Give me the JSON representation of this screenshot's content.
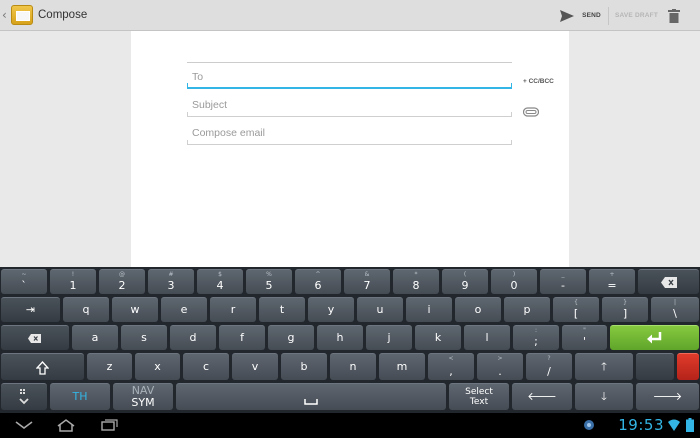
{
  "actionbar": {
    "title": "Compose",
    "send_label": "SEND",
    "save_draft_label": "SAVE DRAFT"
  },
  "compose": {
    "to_placeholder": "To",
    "subject_placeholder": "Subject",
    "body_placeholder": "Compose email",
    "cc_bcc_label": "+ CC/BCC"
  },
  "keyboard": {
    "row1": [
      {
        "sub": "~",
        "main": "`"
      },
      {
        "sub": "!",
        "main": "1"
      },
      {
        "sub": "@",
        "main": "2"
      },
      {
        "sub": "#",
        "main": "3"
      },
      {
        "sub": "$",
        "main": "4"
      },
      {
        "sub": "%",
        "main": "5"
      },
      {
        "sub": "^",
        "main": "6"
      },
      {
        "sub": "&",
        "main": "7"
      },
      {
        "sub": "(",
        "main": "9"
      },
      {
        "sub": ")",
        "main": "0"
      },
      {
        "sub": "_",
        "main": "-"
      },
      {
        "sub": "+",
        "main": "="
      }
    ],
    "row1_extra_8": {
      "sub": "*",
      "main": "8"
    },
    "row2": [
      "q",
      "w",
      "e",
      "r",
      "t",
      "y",
      "u",
      "i",
      "o",
      "p"
    ],
    "row2_brackets": [
      {
        "sub": "{",
        "main": "["
      },
      {
        "sub": "}",
        "main": "]"
      },
      {
        "sub": "|",
        "main": "\\"
      }
    ],
    "row3": [
      "a",
      "s",
      "d",
      "f",
      "g",
      "h",
      "j",
      "k",
      "l"
    ],
    "row3_punct": [
      {
        "sub": ":",
        "main": ";"
      },
      {
        "sub": "\"",
        "main": "'"
      }
    ],
    "row4": [
      "z",
      "x",
      "c",
      "v",
      "b",
      "n",
      "m"
    ],
    "row4_punct": [
      {
        "sub": "<",
        "main": ","
      },
      {
        "sub": ">",
        "main": "."
      },
      {
        "sub": "?",
        "main": "/"
      }
    ],
    "lang_label": "TH",
    "nav_label": "NAV",
    "sym_label": "SYM",
    "select_text_line1": "Select",
    "select_text_line2": "Text"
  },
  "sysbar": {
    "clock": "19:53"
  },
  "colors": {
    "accent": "#33b5e5",
    "enter_key": "#6cb531",
    "delete_key": "#c62b1f"
  }
}
